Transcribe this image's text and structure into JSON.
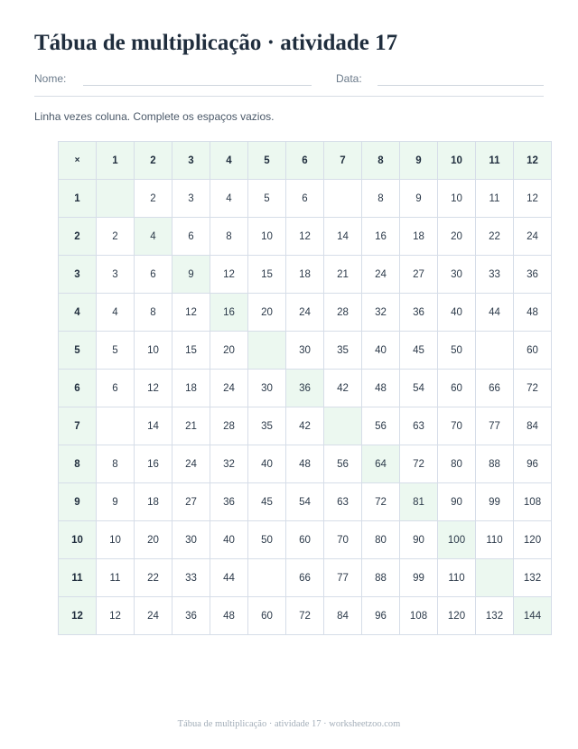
{
  "header": {
    "title": "Tábua de multiplicação · atividade 17",
    "name_label": "Nome:",
    "date_label": "Data:"
  },
  "instructions": "Linha vezes coluna. Complete os espaços vazios.",
  "table": {
    "corner": "×",
    "columns": [
      "1",
      "2",
      "3",
      "4",
      "5",
      "6",
      "7",
      "8",
      "9",
      "10",
      "11",
      "12"
    ],
    "rows": [
      {
        "label": "1",
        "cells": [
          "",
          "2",
          "3",
          "4",
          "5",
          "6",
          "",
          "8",
          "9",
          "10",
          "11",
          "12"
        ]
      },
      {
        "label": "2",
        "cells": [
          "2",
          "4",
          "6",
          "8",
          "10",
          "12",
          "14",
          "16",
          "18",
          "20",
          "22",
          "24"
        ]
      },
      {
        "label": "3",
        "cells": [
          "3",
          "6",
          "9",
          "12",
          "15",
          "18",
          "21",
          "24",
          "27",
          "30",
          "33",
          "36"
        ]
      },
      {
        "label": "4",
        "cells": [
          "4",
          "8",
          "12",
          "16",
          "20",
          "24",
          "28",
          "32",
          "36",
          "40",
          "44",
          "48"
        ]
      },
      {
        "label": "5",
        "cells": [
          "5",
          "10",
          "15",
          "20",
          "",
          "30",
          "35",
          "40",
          "45",
          "50",
          "",
          "60"
        ]
      },
      {
        "label": "6",
        "cells": [
          "6",
          "12",
          "18",
          "24",
          "30",
          "36",
          "42",
          "48",
          "54",
          "60",
          "66",
          "72"
        ]
      },
      {
        "label": "7",
        "cells": [
          "",
          "14",
          "21",
          "28",
          "35",
          "42",
          "",
          "56",
          "63",
          "70",
          "77",
          "84"
        ]
      },
      {
        "label": "8",
        "cells": [
          "8",
          "16",
          "24",
          "32",
          "40",
          "48",
          "56",
          "64",
          "72",
          "80",
          "88",
          "96"
        ]
      },
      {
        "label": "9",
        "cells": [
          "9",
          "18",
          "27",
          "36",
          "45",
          "54",
          "63",
          "72",
          "81",
          "90",
          "99",
          "108"
        ]
      },
      {
        "label": "10",
        "cells": [
          "10",
          "20",
          "30",
          "40",
          "50",
          "60",
          "70",
          "80",
          "90",
          "100",
          "110",
          "120"
        ]
      },
      {
        "label": "11",
        "cells": [
          "11",
          "22",
          "33",
          "44",
          "",
          "66",
          "77",
          "88",
          "99",
          "110",
          "",
          "132"
        ]
      },
      {
        "label": "12",
        "cells": [
          "12",
          "24",
          "36",
          "48",
          "60",
          "72",
          "84",
          "96",
          "108",
          "120",
          "132",
          "144"
        ]
      }
    ]
  },
  "footer": "Tábua de multiplicação · atividade 17 · worksheetzoo.com",
  "colors": {
    "header_cell_bg": "#ecf8f0",
    "grid_border": "#d6dde8",
    "title_text": "#1f2d3d"
  }
}
